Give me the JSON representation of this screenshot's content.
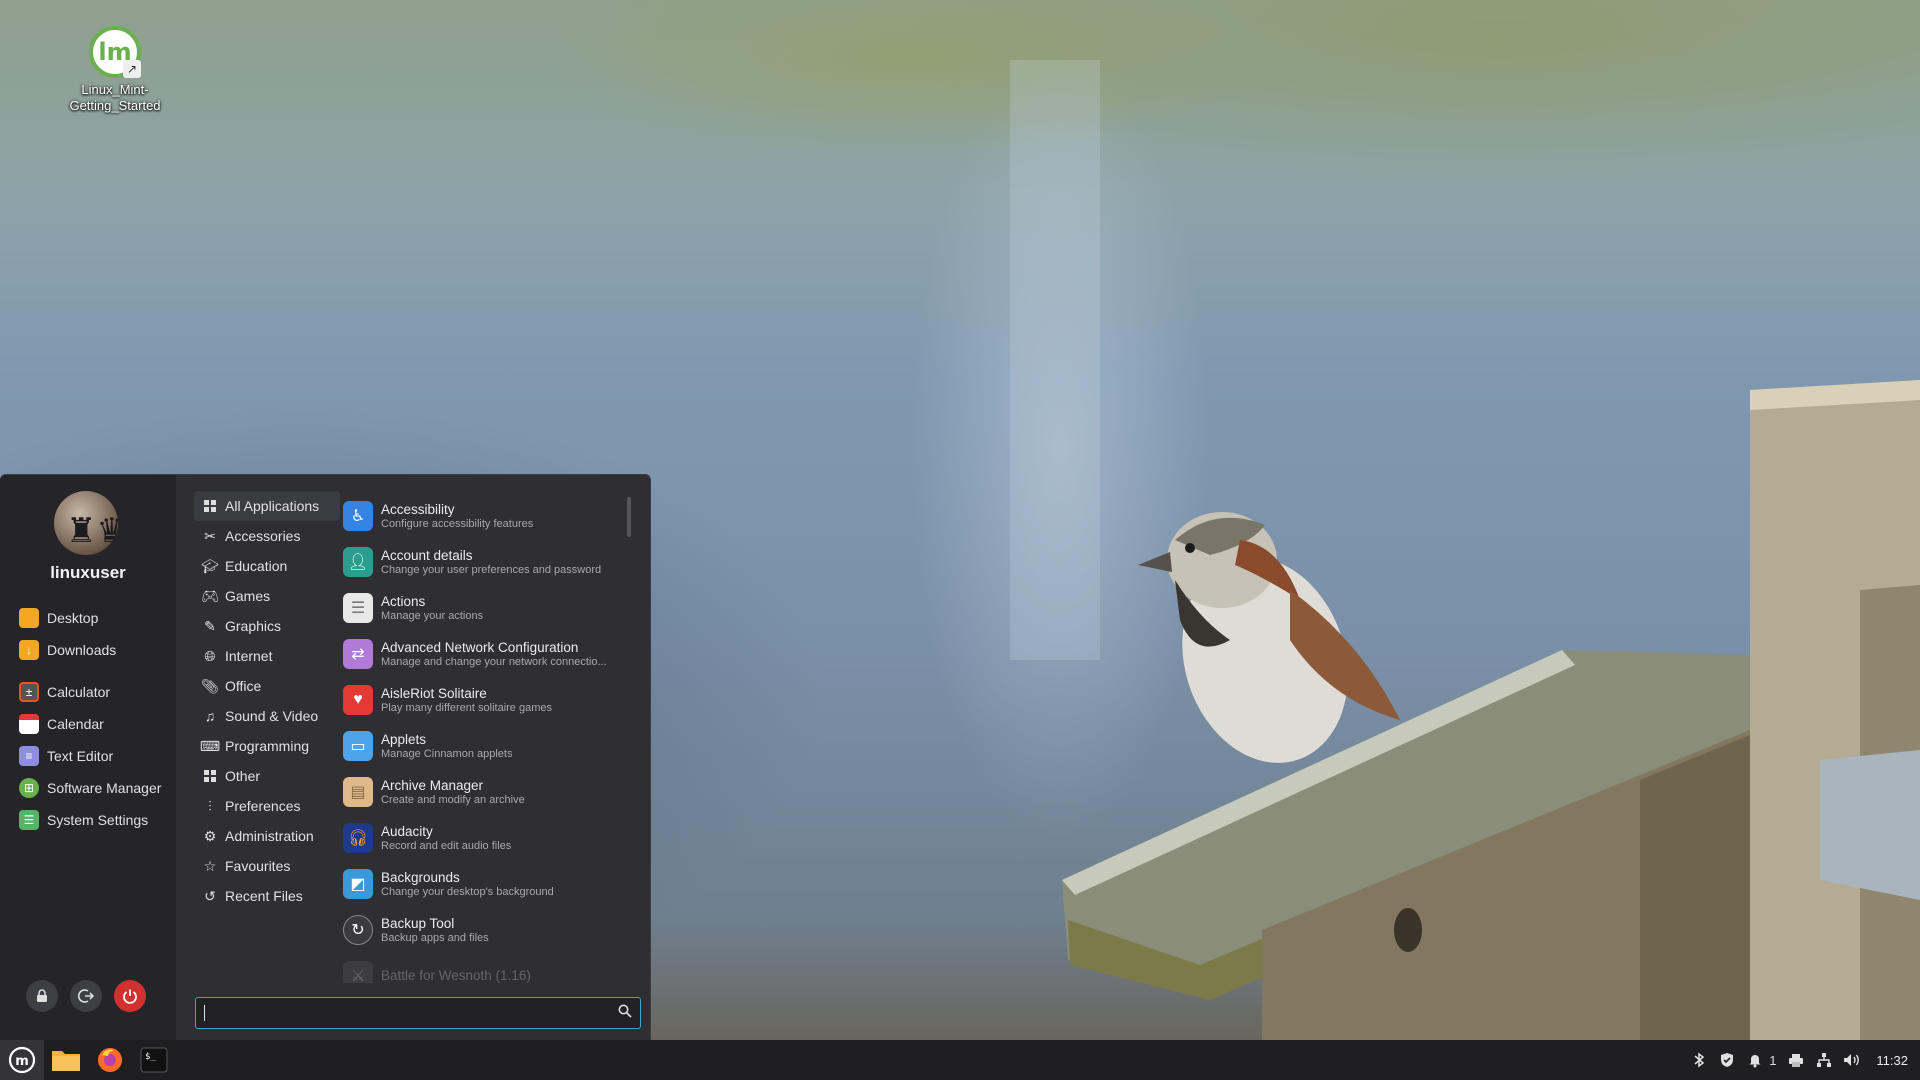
{
  "desktop": {
    "icons": [
      {
        "label": "Linux_Mint-\nGetting_Started",
        "label_line1": "Linux_Mint-",
        "label_line2": "Getting_Started",
        "icon": "linux-mint-logo"
      }
    ]
  },
  "menu": {
    "user": {
      "name": "linuxuser",
      "avatar": "chess-avatar"
    },
    "places": [
      {
        "label": "Desktop",
        "icon": "folder-icon",
        "color": "#f5a623"
      },
      {
        "label": "Downloads",
        "icon": "download-folder-icon",
        "color": "#f5a623"
      }
    ],
    "favorites": [
      {
        "label": "Calculator",
        "icon": "calculator-icon",
        "color": "#e95420"
      },
      {
        "label": "Calendar",
        "icon": "calendar-icon",
        "color": "#ffffff"
      },
      {
        "label": "Text Editor",
        "icon": "text-editor-icon",
        "color": "#8e8ee0"
      },
      {
        "label": "Software Manager",
        "icon": "software-manager-icon",
        "color": "#6ab04c"
      },
      {
        "label": "System Settings",
        "icon": "settings-icon",
        "color": "#58b368"
      }
    ],
    "session_buttons": [
      {
        "label": "Lock Screen",
        "icon": "lock-icon"
      },
      {
        "label": "Log Out",
        "icon": "logout-icon"
      },
      {
        "label": "Quit",
        "icon": "power-icon"
      }
    ],
    "categories": [
      {
        "label": "All Applications",
        "icon": "grid-icon",
        "active": true
      },
      {
        "label": "Accessories",
        "icon": "tools-icon"
      },
      {
        "label": "Education",
        "icon": "graduation-cap-icon"
      },
      {
        "label": "Games",
        "icon": "gamepad-icon"
      },
      {
        "label": "Graphics",
        "icon": "palette-icon"
      },
      {
        "label": "Internet",
        "icon": "globe-icon"
      },
      {
        "label": "Office",
        "icon": "paperclip-icon"
      },
      {
        "label": "Sound & Video",
        "icon": "music-icon"
      },
      {
        "label": "Programming",
        "icon": "code-icon"
      },
      {
        "label": "Other",
        "icon": "grid-icon"
      },
      {
        "label": "Preferences",
        "icon": "sliders-icon"
      },
      {
        "label": "Administration",
        "icon": "gear-icon"
      },
      {
        "label": "Favourites",
        "icon": "star-icon"
      },
      {
        "label": "Recent Files",
        "icon": "history-icon"
      }
    ],
    "apps": [
      {
        "name": "Accessibility",
        "desc": "Configure accessibility features",
        "icon": "accessibility-icon",
        "color": "#3584e4"
      },
      {
        "name": "Account details",
        "desc": "Change your user preferences and password",
        "icon": "account-icon",
        "color": "#2a9d8f"
      },
      {
        "name": "Actions",
        "desc": "Manage your actions",
        "icon": "actions-icon",
        "color": "#e8e8e8"
      },
      {
        "name": "Advanced Network Configuration",
        "desc": "Manage and change your network connectio...",
        "icon": "network-config-icon",
        "color": "#b07ad8"
      },
      {
        "name": "AisleRiot Solitaire",
        "desc": "Play many different solitaire games",
        "icon": "solitaire-icon",
        "color": "#e53935"
      },
      {
        "name": "Applets",
        "desc": "Manage Cinnamon applets",
        "icon": "applets-icon",
        "color": "#4fa3e8"
      },
      {
        "name": "Archive Manager",
        "desc": "Create and modify an archive",
        "icon": "archive-icon",
        "color": "#e0b98a"
      },
      {
        "name": "Audacity",
        "desc": "Record and edit audio files",
        "icon": "audacity-icon",
        "color": "#1e3a8a"
      },
      {
        "name": "Backgrounds",
        "desc": "Change your desktop's background",
        "icon": "backgrounds-icon",
        "color": "#3a9ad9"
      },
      {
        "name": "Backup Tool",
        "desc": "Backup apps and files",
        "icon": "backup-icon",
        "color": "#3a3a3f"
      },
      {
        "name": "Battle for Wesnoth (1.16)",
        "desc": "",
        "icon": "wesnoth-icon",
        "color": "#666666"
      }
    ],
    "search": {
      "value": "",
      "placeholder": ""
    }
  },
  "panel": {
    "launchers": [
      {
        "label": "Menu",
        "icon": "linux-mint-logo"
      },
      {
        "label": "Files",
        "icon": "folder-icon"
      },
      {
        "label": "Firefox",
        "icon": "firefox-icon"
      },
      {
        "label": "Terminal",
        "icon": "terminal-icon"
      }
    ],
    "tray": {
      "notification_count": "1",
      "clock": "11:32"
    }
  }
}
